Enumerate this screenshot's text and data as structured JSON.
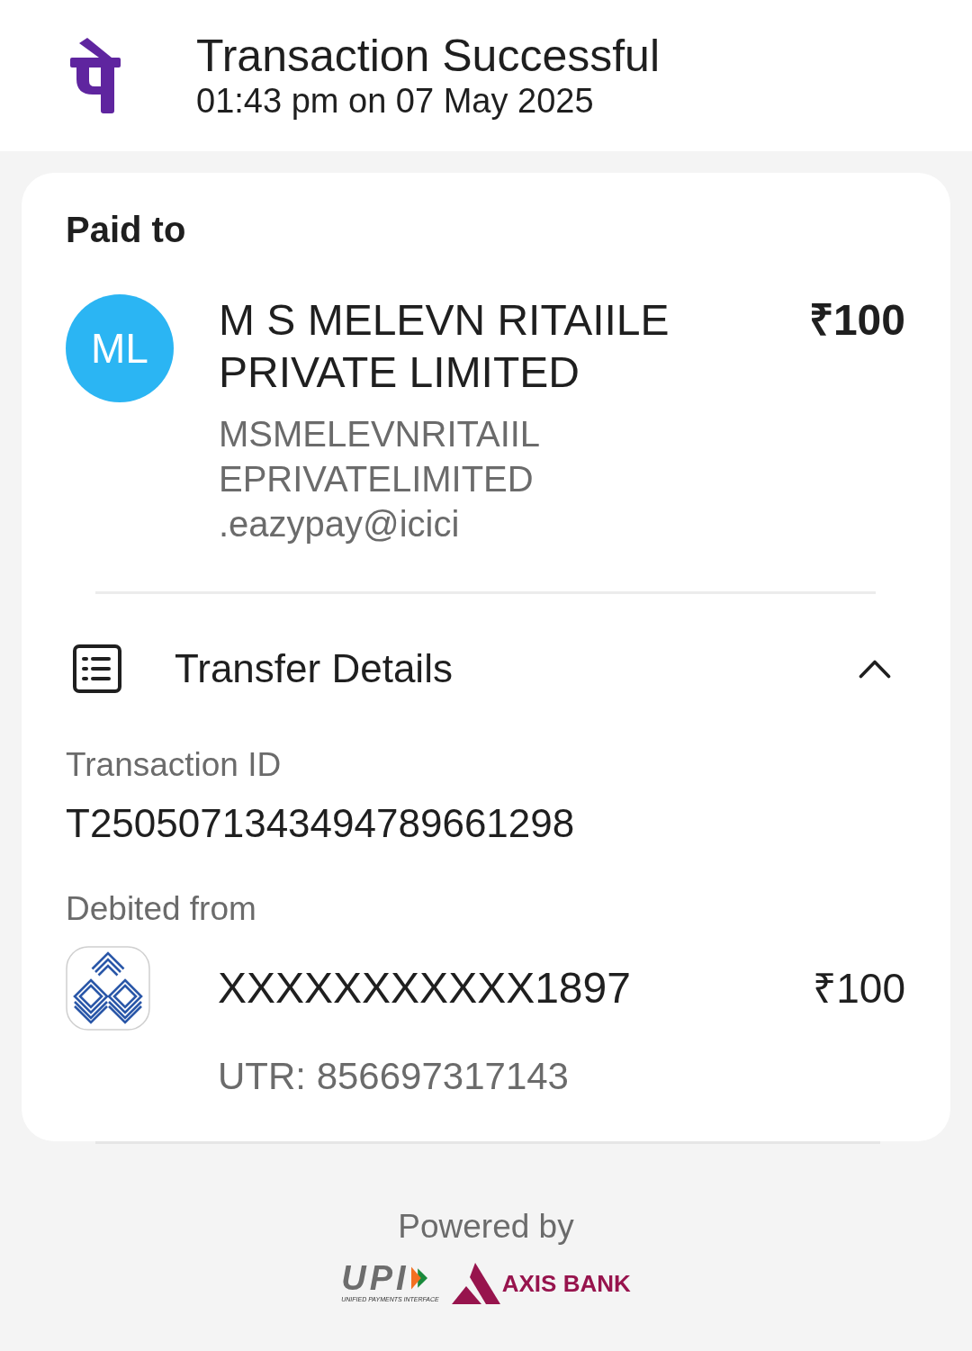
{
  "header": {
    "title": "Transaction Successful",
    "timestamp": "01:43 pm on 07 May 2025"
  },
  "paid_to": {
    "heading": "Paid to",
    "avatar_initials": "ML",
    "name": "M S MELEVN RITAIILE PRIVATE LIMITED",
    "upi_id": "MSMELEVNRITAIILEPRIVATELIMITED.eazypay@icici",
    "amount": "₹100"
  },
  "transfer_details": {
    "title": "Transfer Details",
    "expanded": true,
    "fields": [
      {
        "label": "Transaction ID",
        "value": "T2505071343494789661298"
      }
    ],
    "debited_from": {
      "label": "Debited from",
      "account": "XXXXXXXXXXX1897",
      "amount": "₹100",
      "utr": "UTR: 856697317143"
    }
  },
  "footer": {
    "powered_by": "Powered by",
    "upi_wordmark": "UPI",
    "upi_tagline": "UNIFIED PAYMENTS INTERFACE",
    "bank_name": "AXIS BANK"
  }
}
